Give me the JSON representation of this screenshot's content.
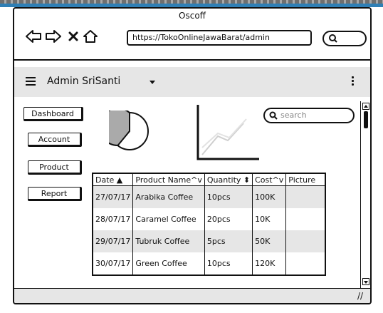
{
  "window": {
    "title": "Oscoff"
  },
  "browser": {
    "url": "https://TokoOnlineJawaBarat/admin",
    "search_placeholder": ""
  },
  "app": {
    "title": "Admin SriSanti"
  },
  "sidebar": {
    "items": [
      {
        "label": "Dashboard"
      },
      {
        "label": "Account"
      },
      {
        "label": "Product"
      },
      {
        "label": "Report"
      }
    ]
  },
  "search": {
    "placeholder": "search"
  },
  "icons": [
    "back-arrow-icon",
    "forward-arrow-icon",
    "close-icon",
    "home-icon",
    "search-icon",
    "hamburger-menu-icon",
    "chevron-down-icon",
    "kebab-menu-icon",
    "pie-chart-icon",
    "line-chart-icon",
    "resize-grip-icon"
  ],
  "table": {
    "columns": [
      "Date ▲",
      "Product Name^v",
      "Quantity ⬍",
      "Cost^v",
      "Picture"
    ],
    "rows": [
      [
        "27/07/17",
        "Arabika Coffee",
        "10pcs",
        "100K",
        ""
      ],
      [
        "28/07/17",
        "Caramel Coffee",
        "20pcs",
        "10K",
        ""
      ],
      [
        "29/07/17",
        "Tubruk Coffee",
        "5pcs",
        "50K",
        ""
      ],
      [
        "30/07/17",
        "Green Coffee",
        "10pcs",
        "120K",
        ""
      ]
    ]
  },
  "colors": {
    "accent_bar": "#2f7fb5",
    "bar_bg": "#e6e6e6",
    "row_alt": "#e6e6e6"
  }
}
